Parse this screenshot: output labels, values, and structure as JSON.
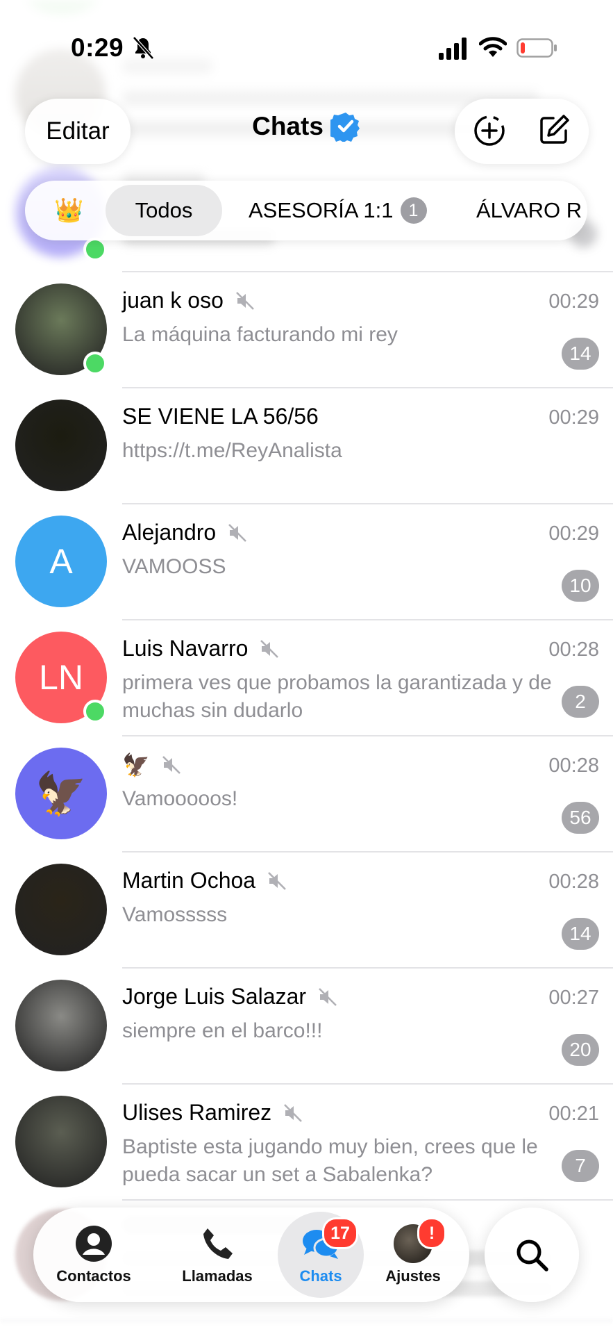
{
  "status_bar": {
    "time": "0:29"
  },
  "header": {
    "edit_label": "Editar",
    "title": "Chats"
  },
  "tabs": {
    "crown": "👑",
    "active": "Todos",
    "asesoria": "ASESORÍA 1:1",
    "asesoria_badge": "1",
    "alvaro": "ÁLVARO R"
  },
  "chats": [
    {
      "name": "juan k oso",
      "time": "00:29",
      "message": "La máquina facturando mi rey",
      "unread": "14",
      "muted": true,
      "online": true,
      "avatar_color": "#6b7a5a"
    },
    {
      "name": "SE VIENE LA 56/56",
      "time": "00:29",
      "message": "https://t.me/ReyAnalista",
      "unread": "",
      "muted": false,
      "online": false,
      "avatar_color": "#1c1c10"
    },
    {
      "name": "Alejandro",
      "time": "00:29",
      "message": "VAMOOSS",
      "unread": "10",
      "muted": true,
      "online": false,
      "avatar_text": "A",
      "avatar_color": "#3da7f0"
    },
    {
      "name": "Luis Navarro",
      "time": "00:28",
      "message": "primera ves que probamos la garantizada y de muchas sin dudarlo",
      "unread": "2",
      "muted": true,
      "online": true,
      "avatar_text": "LN",
      "avatar_color": "#fd5a60"
    },
    {
      "name": "🦅",
      "time": "00:28",
      "message": "Vamooooos!",
      "unread": "56",
      "muted": true,
      "online": false,
      "avatar_text": "🦅",
      "avatar_color": "#6c6cf0"
    },
    {
      "name": "Martin Ochoa",
      "time": "00:28",
      "message": "Vamosssss",
      "unread": "14",
      "muted": true,
      "online": false,
      "avatar_color": "#2a2418"
    },
    {
      "name": "Jorge Luis Salazar",
      "time": "00:27",
      "message": "siempre en el barco!!!",
      "unread": "20",
      "muted": true,
      "online": false,
      "avatar_color": "#8a8a86"
    },
    {
      "name": "Ulises Ramirez",
      "time": "00:21",
      "message": "Baptiste esta jugando muy bien, crees que le pueda sacar un set a Sabalenka?",
      "unread": "7",
      "muted": true,
      "online": false,
      "avatar_color": "#5b5e52"
    }
  ],
  "tab_bar": {
    "contacts": "Contactos",
    "calls": "Llamadas",
    "chats": "Chats",
    "chats_badge": "17",
    "settings": "Ajustes",
    "settings_badge": "!"
  },
  "colors": {
    "accent": "#1d8cf0",
    "online": "#4cd964",
    "badge_red": "#ff3b30",
    "unread_gray": "#a7a7ab"
  }
}
